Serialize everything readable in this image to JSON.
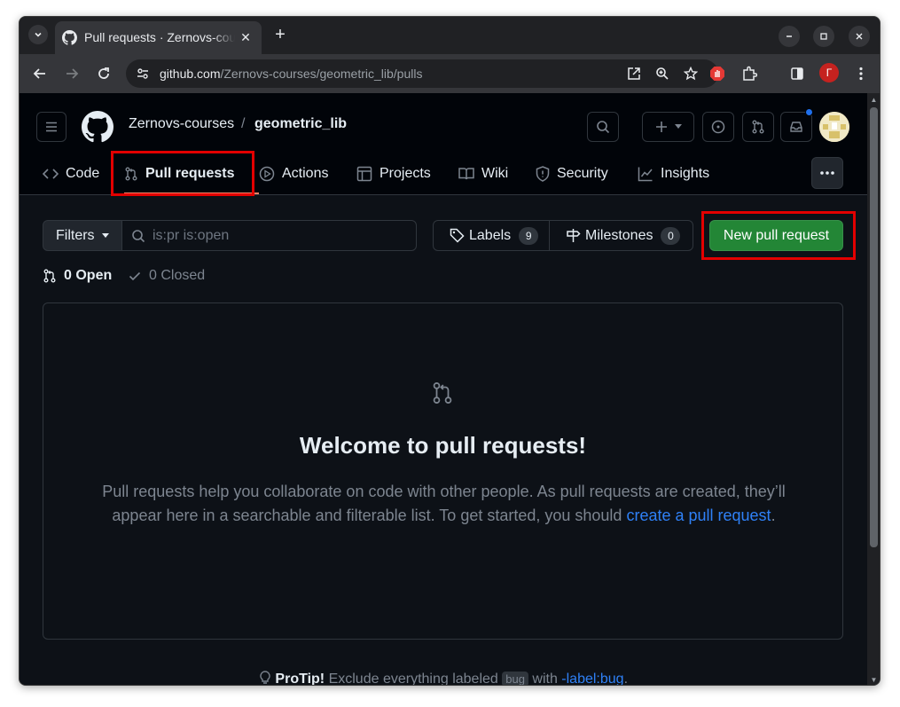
{
  "browser": {
    "tab_title": "Pull requests · Zernovs-courses/geometric_lib",
    "url_host": "github.com",
    "url_path": "/Zernovs-courses/geometric_lib/pulls",
    "profile_initial": "Г"
  },
  "header": {
    "owner": "Zernovs-courses",
    "separator": "/",
    "repo": "geometric_lib"
  },
  "repo_nav": {
    "code": "Code",
    "pull_requests": "Pull requests",
    "actions": "Actions",
    "projects": "Projects",
    "wiki": "Wiki",
    "security": "Security",
    "insights": "Insights"
  },
  "toolbar": {
    "filters_label": "Filters",
    "search_placeholder": "is:pr is:open",
    "labels_label": "Labels",
    "labels_count": "9",
    "milestones_label": "Milestones",
    "milestones_count": "0",
    "new_pr_label": "New pull request"
  },
  "states": {
    "open_label": "0 Open",
    "closed_label": "0 Closed"
  },
  "blankslate": {
    "title": "Welcome to pull requests!",
    "text": "Pull requests help you collaborate on code with other people. As pull requests are created, they’ll appear here in a searchable and filterable list. To get started, you should ",
    "link": "create a pull request",
    "text_end": "."
  },
  "protip": {
    "label": "ProTip!",
    "text1": " Exclude everything labeled ",
    "code": "bug",
    "text2": " with ",
    "link": "-label:bug",
    "text3": "."
  },
  "colors": {
    "accent_green": "#238636",
    "link_blue": "#2f81f7",
    "annotation_red": "#e30000"
  }
}
